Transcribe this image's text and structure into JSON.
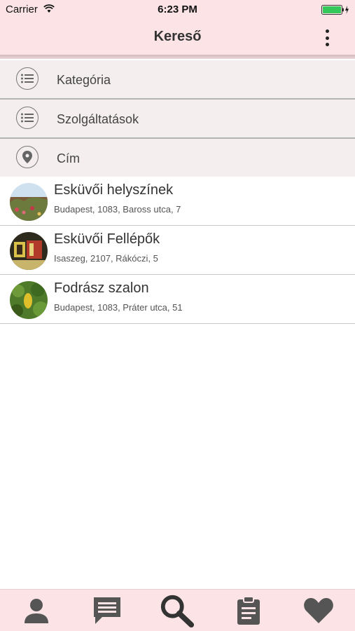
{
  "status_bar": {
    "carrier": "Carrier",
    "time": "6:23 PM",
    "icons": [
      "wifi-icon",
      "battery-icon",
      "charging-icon"
    ]
  },
  "nav": {
    "title": "Kereső",
    "menu_icon": "more-vertical-icon"
  },
  "filters": [
    {
      "label": "Kategória",
      "icon": "list-icon"
    },
    {
      "label": "Szolgáltatások",
      "icon": "list-icon"
    },
    {
      "label": "Cím",
      "icon": "location-pin-icon"
    }
  ],
  "results": [
    {
      "title": "Esküvői helyszínek",
      "address": "Budapest, 1083, Baross utca, 7"
    },
    {
      "title": "Esküvői Fellépők",
      "address": "Isaszeg, 2107, Rákóczi, 5"
    },
    {
      "title": "Fodrász szalon",
      "address": "Budapest, 1083, Práter utca, 51"
    }
  ],
  "tab_bar": {
    "tabs": [
      {
        "icon": "person-icon"
      },
      {
        "icon": "chat-icon"
      },
      {
        "icon": "search-icon",
        "active": true
      },
      {
        "icon": "clipboard-icon"
      },
      {
        "icon": "heart-icon"
      }
    ]
  },
  "colors": {
    "header_bg": "#fbe3e6",
    "filter_bg": "#f4eeee",
    "icon_gray": "#555555"
  }
}
